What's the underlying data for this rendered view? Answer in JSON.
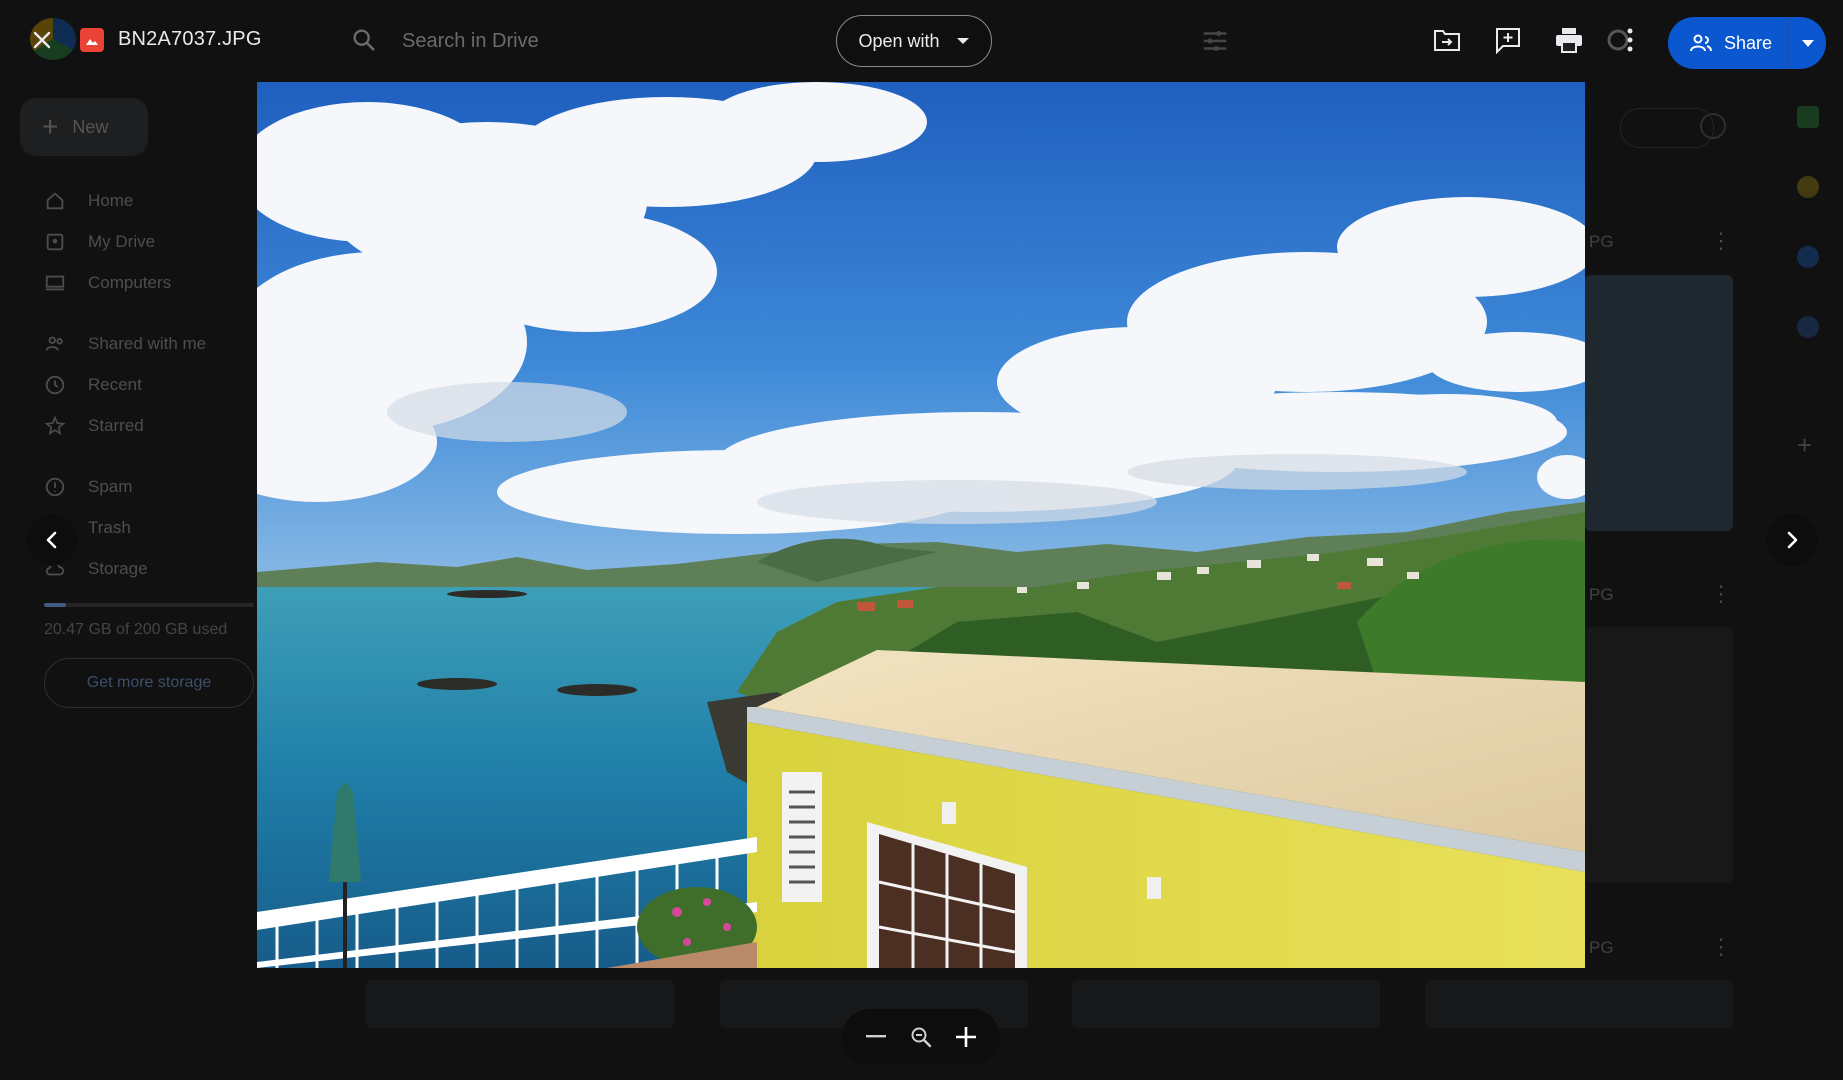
{
  "viewer": {
    "file_name": "BN2A7037.JPG",
    "search_placeholder": "Search in Drive",
    "open_with_label": "Open with",
    "share_label": "Share"
  },
  "drive_background": {
    "new_label": "New",
    "nav": [
      {
        "label": "Home",
        "icon": "home-icon"
      },
      {
        "label": "My Drive",
        "icon": "drive-icon"
      },
      {
        "label": "Computers",
        "icon": "computer-icon"
      },
      {
        "label": "Shared with me",
        "icon": "people-icon"
      },
      {
        "label": "Recent",
        "icon": "clock-icon"
      },
      {
        "label": "Starred",
        "icon": "star-icon"
      },
      {
        "label": "Spam",
        "icon": "spam-icon"
      },
      {
        "label": "Trash",
        "icon": "trash-icon"
      },
      {
        "label": "Storage",
        "icon": "cloud-icon"
      }
    ],
    "storage_used": "20.47 GB of 200 GB used",
    "storage_button": "Get more storage",
    "file_suffix": "PG"
  },
  "colors": {
    "share_blue": "#0b57d0",
    "file_icon_red": "#ea4335"
  }
}
